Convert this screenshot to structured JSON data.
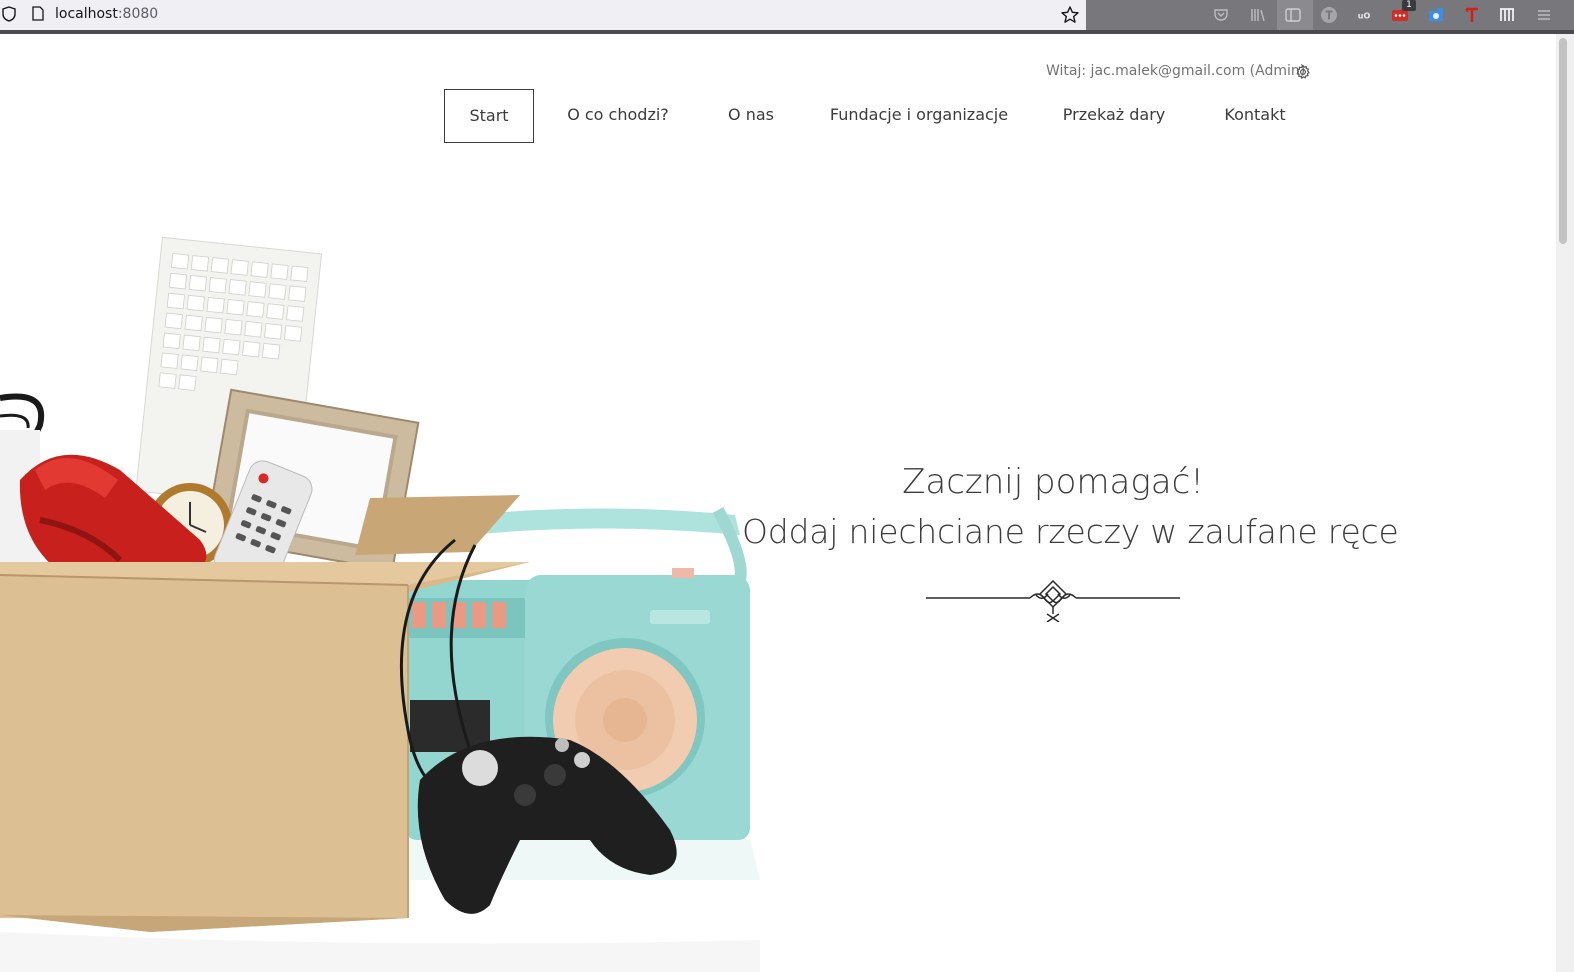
{
  "browser": {
    "url_host": "localhost",
    "url_port": ":8080",
    "toolbar_badge": "1",
    "icons": [
      "shield-icon",
      "page-icon",
      "bookmark-star-icon",
      "pocket-icon",
      "library-icon",
      "sidebar-icon",
      "extension-t-icon",
      "ublock-icon",
      "lastpass-icon",
      "screenshot-icon",
      "translate-t-icon",
      "columns-icon",
      "hamburger-menu-icon"
    ]
  },
  "header": {
    "welcome_text": "Witaj: jac.malek@gmail.com (Admin)",
    "settings_icon": "gear-icon"
  },
  "nav": {
    "items": [
      "Start",
      "O co chodzi?",
      "O nas",
      "Fundacje i organizacje",
      "Przekaż dary",
      "Kontakt"
    ],
    "active": "Start"
  },
  "hero": {
    "title_line1": "Zacznij pomagać!",
    "title_line2": "Oddaj niechciane rzeczy w zaufane ręce",
    "image": "box-of-donated-items-illustration",
    "ornament": "decorative-divider-icon"
  },
  "colors": {
    "text": "#3c3c3c",
    "muted": "#737373",
    "box": "#d9b98c",
    "radio": "#93d5cf"
  }
}
